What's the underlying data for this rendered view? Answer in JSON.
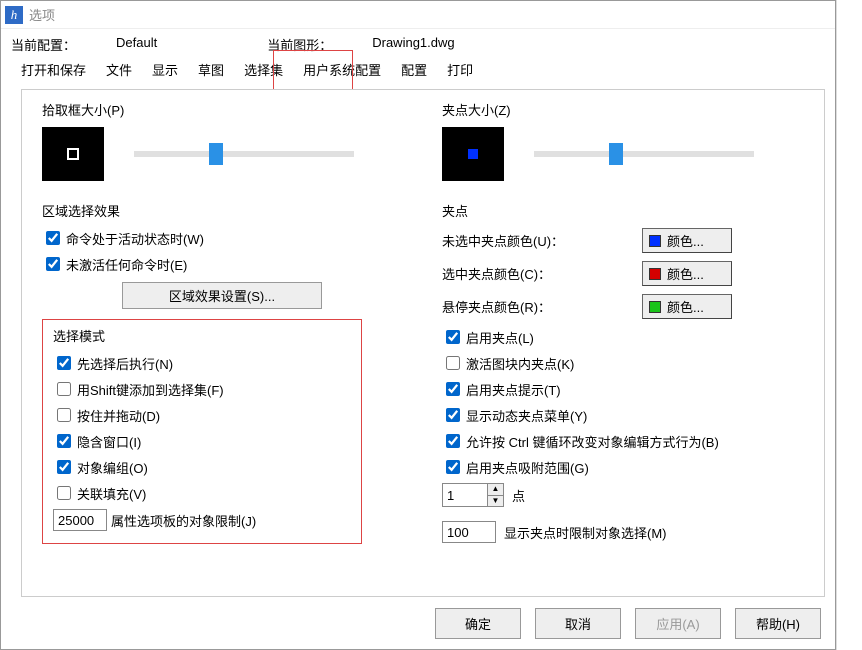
{
  "window_title": "选项",
  "info": {
    "config_label": "当前配置：",
    "config_value": "Default",
    "drawing_label": "当前图形：",
    "drawing_value": "Drawing1.dwg"
  },
  "tabs": [
    "打开和保存",
    "文件",
    "显示",
    "草图",
    "选择集",
    "用户系统配置",
    "配置",
    "打印"
  ],
  "left": {
    "pickbox_label": "拾取框大小(P)",
    "area_effect_label": "区域选择效果",
    "chk_active": "命令处于活动状态时(W)",
    "chk_inactive": "未激活任何命令时(E)",
    "area_settings_btn": "区域效果设置(S)...",
    "select_mode_label": "选择模式",
    "chk_pre": "先选择后执行(N)",
    "chk_shift": "用Shift键添加到选择集(F)",
    "chk_pressdrag": "按住并拖动(D)",
    "chk_implied": "隐含窗口(I)",
    "chk_group": "对象编组(O)",
    "chk_hatch": "关联填充(V)",
    "obj_limit": "25000",
    "obj_limit_label": "属性选项板的对象限制(J)"
  },
  "right": {
    "grip_label": "夹点大小(Z)",
    "grips_label": "夹点",
    "unsel_color_label": "未选中夹点颜色(U)：",
    "sel_color_label": "选中夹点颜色(C)：",
    "hover_color_label": "悬停夹点颜色(R)：",
    "color_btn_text": "颜色...",
    "chk_enable_grip": "启用夹点(L)",
    "chk_block_grip": "激活图块内夹点(K)",
    "chk_grip_tip": "启用夹点提示(T)",
    "chk_dyn_menu": "显示动态夹点菜单(Y)",
    "chk_ctrl": "允许按 Ctrl 键循环改变对象编辑方式行为(B)",
    "chk_snap_range": "启用夹点吸附范围(G)",
    "spinner_val": "1",
    "spinner_label": "点",
    "limit_val": "100",
    "limit_label": "显示夹点时限制对象选择(M)"
  },
  "buttons": {
    "ok": "确定",
    "cancel": "取消",
    "apply": "应用(A)",
    "help": "帮助(H)"
  },
  "colors": {
    "unselected": "#0030ff",
    "selected": "#d40000",
    "hover": "#1ac41a"
  }
}
